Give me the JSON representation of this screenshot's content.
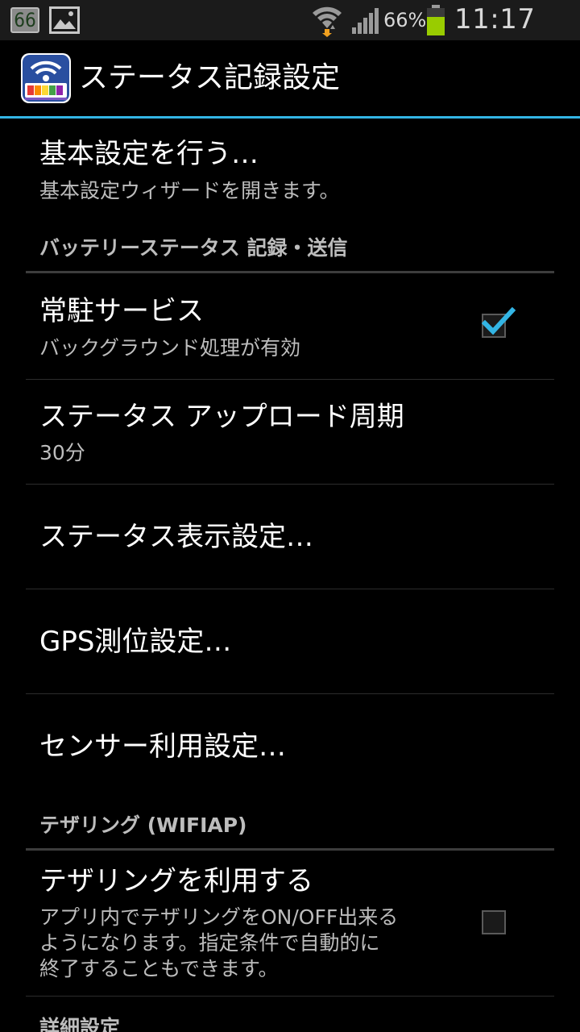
{
  "status_bar": {
    "badge": "66",
    "battery_percent": "66%",
    "time": "11:17 AM",
    "icons": [
      "notification-badge-icon",
      "gallery-icon",
      "wifi-icon",
      "signal-icon",
      "battery-icon"
    ]
  },
  "title_bar": {
    "title": "ステータス記録設定",
    "icon": "app-battery-wifi-icon"
  },
  "items": {
    "basic_setup": {
      "title": "基本設定を行う…",
      "summary": "基本設定ウィザードを開きます。"
    },
    "category_battery": "バッテリーステータス 記録・送信",
    "resident_service": {
      "title": "常駐サービス",
      "summary": "バックグラウンド処理が有効",
      "checked": true
    },
    "upload_period": {
      "title": "ステータス アップロード周期",
      "summary": "30分"
    },
    "status_display": {
      "title": "ステータス表示設定…"
    },
    "gps": {
      "title": "GPS測位設定…"
    },
    "sensor": {
      "title": "センサー利用設定…"
    },
    "category_tethering": "テザリング (WIFIAP)",
    "use_tethering": {
      "title": "テザリングを利用する",
      "summary_lines": [
        "アプリ内でテザリングをON/OFF出来る",
        "ようになります。指定条件で自動的に",
        "終了することもできます。"
      ],
      "checked": false
    },
    "category_advanced": "詳細設定"
  },
  "colors": {
    "accent": "#33b5e5",
    "background": "#000000",
    "battery_green": "#99cc00"
  }
}
